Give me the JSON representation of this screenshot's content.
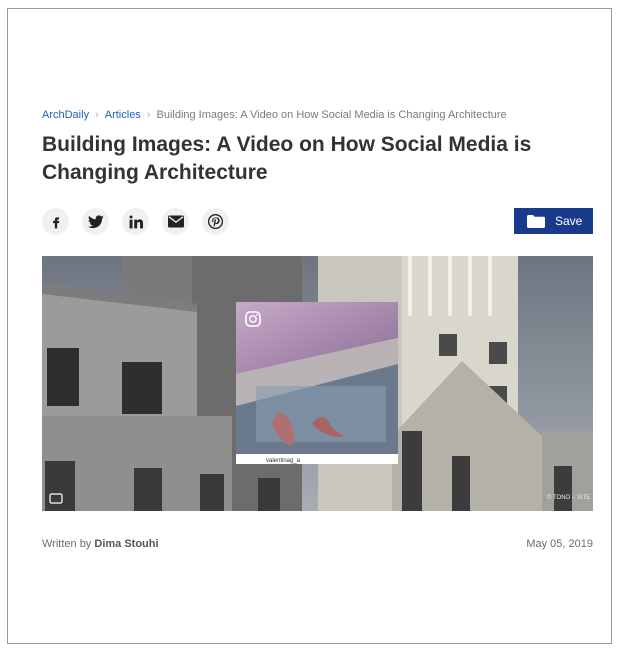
{
  "breadcrumb": {
    "items": [
      "ArchDaily",
      "Articles",
      "Building Images: A Video on How Social Media is Changing Architecture"
    ]
  },
  "article": {
    "title": "Building Images: A Video on How Social Media is Changing Architecture",
    "save_label": "Save",
    "byline_prefix": "Written by",
    "author": "Dima Stouhi",
    "date": "May 05, 2019"
  },
  "share": {
    "icons": [
      "facebook-icon",
      "twitter-icon",
      "linkedin-icon",
      "email-icon",
      "pinterest-icon"
    ]
  },
  "hero": {
    "instagram_user": "valentinag_a",
    "credit": "© TONO – SITE"
  },
  "colors": {
    "accent": "#1a3a8c",
    "link": "#1a63b8"
  }
}
